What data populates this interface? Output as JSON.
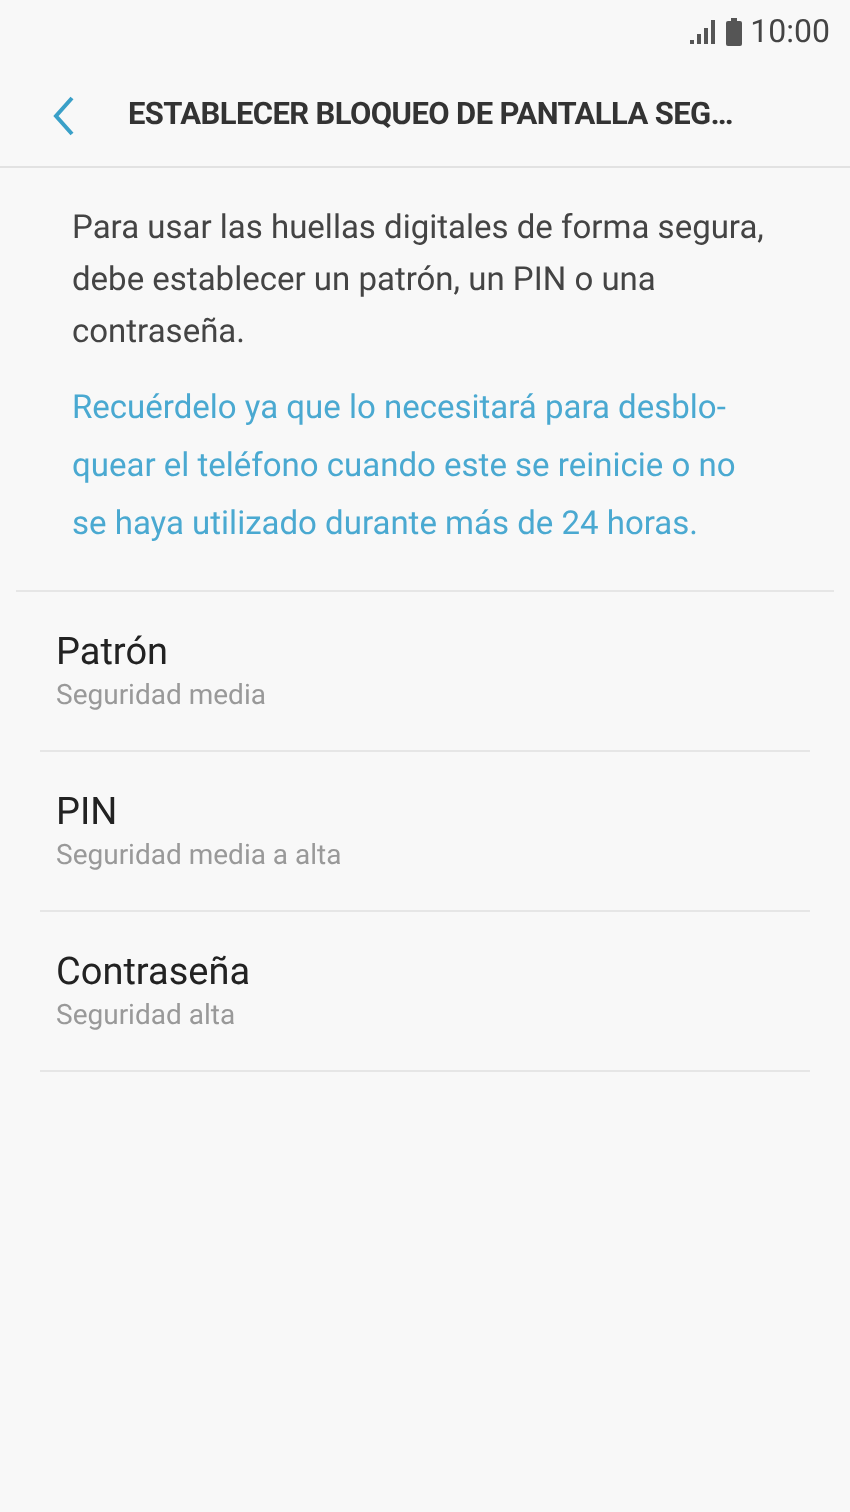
{
  "status_bar": {
    "time": "10:00"
  },
  "header": {
    "title": "ESTABLECER BLOQUEO DE PANTALLA SEG…"
  },
  "intro": "Para usar las huellas digitales de forma segura, debe establecer un patrón, un PIN o una contraseña.",
  "notice": "Recuérdelo ya que lo necesitará para desblo-quear el teléfono cuando este se reinicie o no se haya utilizado durante más de 24 horas.",
  "options": [
    {
      "title": "Patrón",
      "subtitle": "Seguridad media"
    },
    {
      "title": "PIN",
      "subtitle": "Seguridad media a alta"
    },
    {
      "title": "Contraseña",
      "subtitle": "Seguridad alta"
    }
  ]
}
